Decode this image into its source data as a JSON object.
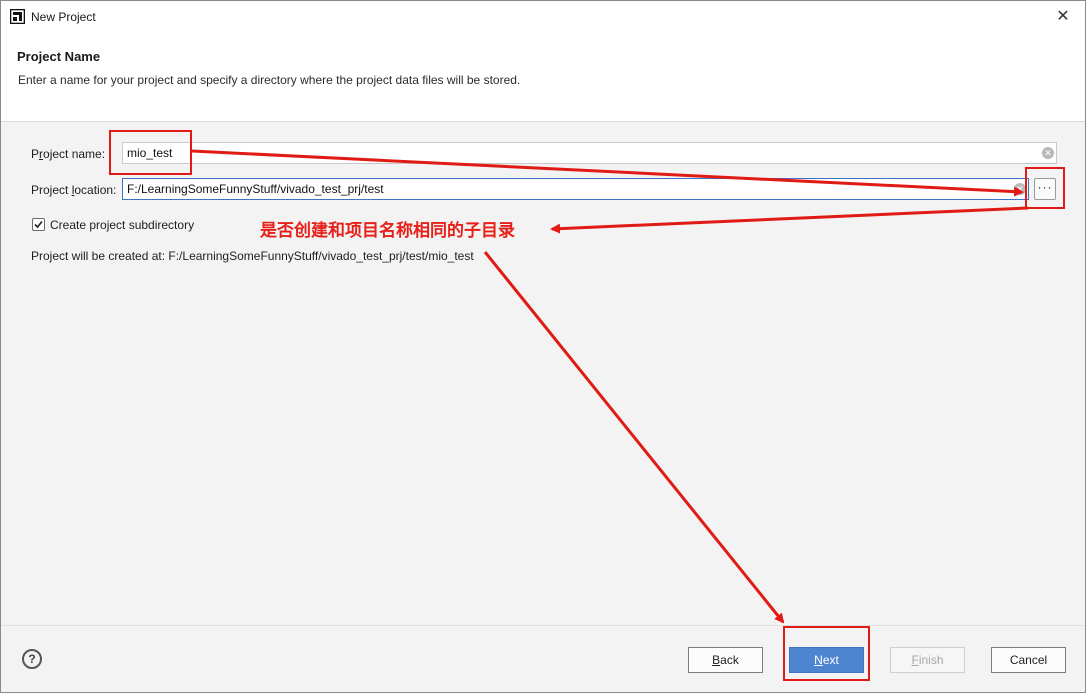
{
  "window": {
    "title": "New Project",
    "close_glyph": "✕",
    "app_icon": "vivado-logo-icon"
  },
  "header": {
    "title": "Project Name",
    "description": "Enter a name for your project and specify a directory where the project data files will be stored."
  },
  "form": {
    "project_name_label_pre": "P",
    "project_name_label_u": "r",
    "project_name_label_post": "oject name:",
    "project_name_value": "mio_test",
    "project_location_label_pre": "Project ",
    "project_location_label_u": "l",
    "project_location_label_post": "ocation:",
    "project_location_value": "F:/LearningSomeFunnyStuff/vivado_test_prj/test",
    "browse_label": "···",
    "subdirectory_label": "Create project subdirectory",
    "subdirectory_checked": true,
    "created_at_label": "Project will be created at: F:/LearningSomeFunnyStuff/vivado_test_prj/test/mio_test"
  },
  "annotation": {
    "text": "是否创建和项目名称相同的子目录",
    "color": "#e8201a"
  },
  "footer": {
    "help_glyph": "?",
    "back_u": "B",
    "back_rest": "ack",
    "next_u": "N",
    "next_rest": "ext",
    "finish_u": "F",
    "finish_rest": "inish",
    "cancel_label": "Cancel"
  },
  "colors": {
    "accent": "#4e85d0",
    "annotation_red": "#e01a14"
  }
}
